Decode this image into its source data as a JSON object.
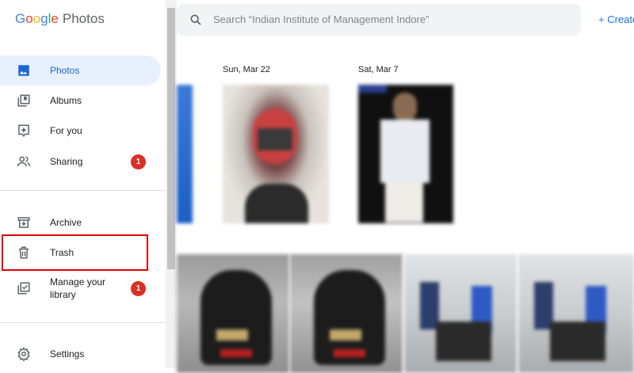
{
  "app": {
    "logo_parts": [
      "G",
      "o",
      "o",
      "g",
      "l",
      "e"
    ],
    "product": "Photos"
  },
  "sidebar": {
    "items": [
      {
        "label": "Photos",
        "icon": "photo-icon",
        "active": true
      },
      {
        "label": "Albums",
        "icon": "album-icon"
      },
      {
        "label": "For you",
        "icon": "for-you-icon"
      },
      {
        "label": "Sharing",
        "icon": "sharing-icon",
        "badge": "1"
      },
      {
        "label": "Archive",
        "icon": "archive-icon"
      },
      {
        "label": "Trash",
        "icon": "trash-icon",
        "highlighted": true
      },
      {
        "label": "Manage your",
        "label2": "library",
        "icon": "manage-library-icon",
        "badge": "1"
      },
      {
        "label": "Settings",
        "icon": "settings-icon"
      }
    ]
  },
  "search": {
    "placeholder": "Search “Indian Institute of Management Indore”"
  },
  "toolbar": {
    "create_label": "+ Create"
  },
  "dates": [
    "Sun, Mar 22",
    "Sat, Mar 7"
  ],
  "colors": {
    "accent": "#1a73e8",
    "active_bg": "#e8f0fe",
    "badge": "#d93025",
    "highlight": "#e00000"
  }
}
